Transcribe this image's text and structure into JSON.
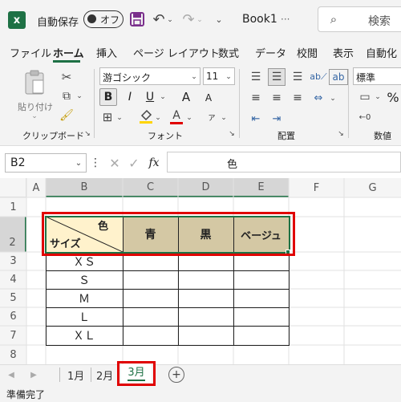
{
  "app": {
    "autosave_label": "自動保存",
    "autosave_state": "オフ",
    "file_name": "Book1",
    "file_suffix": "···",
    "search_placeholder": "検索"
  },
  "ribbon_tabs": [
    "ファイル",
    "ホーム",
    "挿入",
    "ページ レイアウト",
    "数式",
    "データ",
    "校閲",
    "表示",
    "自動化"
  ],
  "ribbon": {
    "paste_label": "貼り付け",
    "clipboard_group": "クリップボード",
    "font_name": "游ゴシック",
    "font_size": "11",
    "font_group": "フォント",
    "bold": "B",
    "italic": "I",
    "underline": "U",
    "grow_font": "A",
    "shrink_font": "A",
    "phonetic": "ア",
    "align_group": "配置",
    "number_format": "標準",
    "number_group": "数値",
    "percent": "%"
  },
  "formula_bar": {
    "name_box": "B2",
    "fx": "fx",
    "content": "色"
  },
  "columns": [
    "A",
    "B",
    "C",
    "D",
    "E",
    "F",
    "G"
  ],
  "rows": [
    "1",
    "2",
    "3",
    "4",
    "5",
    "6",
    "7",
    "8"
  ],
  "table": {
    "header_diag_top": "色",
    "header_diag_bottom": "サイズ",
    "header_cols": [
      "青",
      "黒",
      "ベージュ"
    ],
    "sizes": [
      "ＸＳ",
      "Ｓ",
      "Ｍ",
      "Ｌ",
      "ＸＬ"
    ],
    "header_fill": "#d4c8a4",
    "header_fill_b": "#fff2cc"
  },
  "sheet_tabs": [
    "1月",
    "2月",
    "3月"
  ],
  "active_sheet": "3月",
  "status": "準備完了",
  "colors": {
    "accent_green": "#1e7145",
    "highlight_red": "#e00000",
    "font_red": "#e00000"
  }
}
